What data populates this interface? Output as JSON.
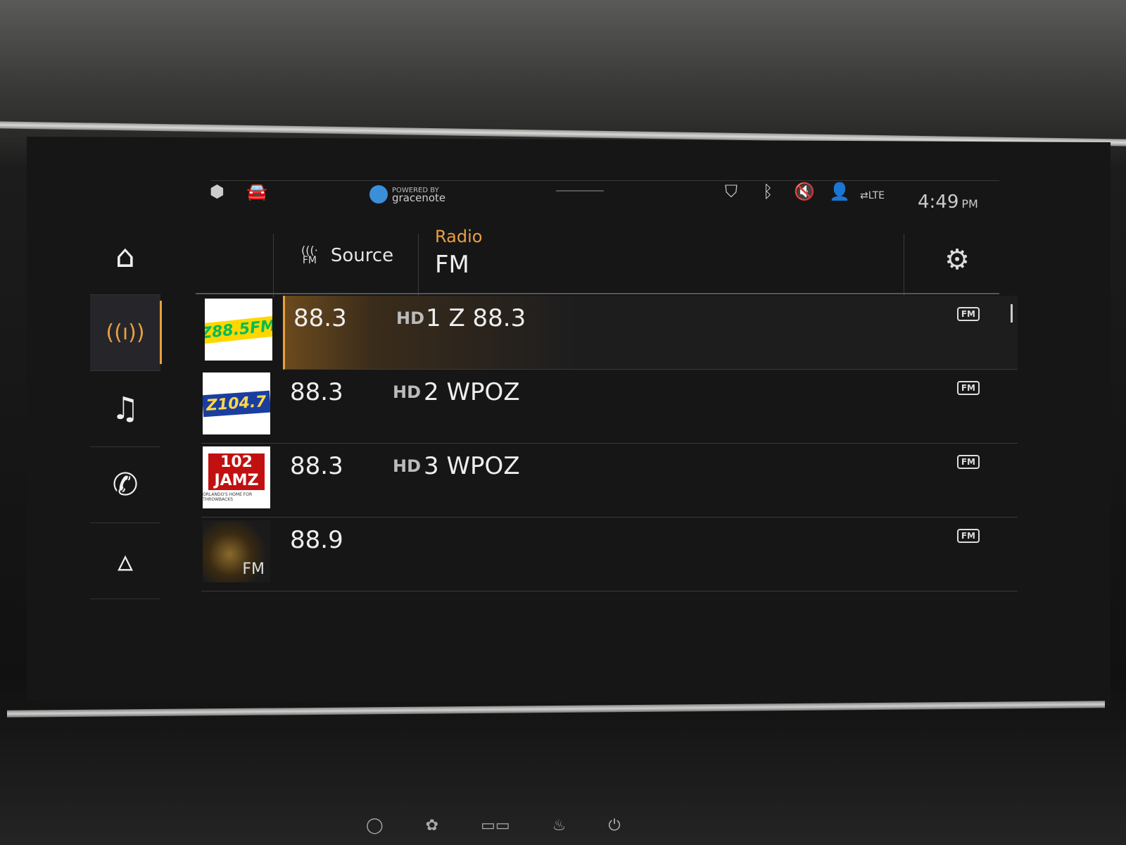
{
  "status_bar": {
    "icons_left": [
      "cube-icon",
      "car-info-icon"
    ],
    "gracenote": {
      "powered_by": "POWERED BY",
      "brand": "gracenote"
    },
    "icons_right": [
      "location-shield-icon",
      "bluetooth-icon",
      "mute-icon",
      "driver-profile-icon",
      "lte-icon"
    ],
    "time": "4:49",
    "ampm": "PM"
  },
  "sidebar": {
    "items": [
      {
        "name": "home",
        "icon": "home-icon",
        "active": false
      },
      {
        "name": "radio",
        "icon": "radio-icon",
        "active": true
      },
      {
        "name": "media",
        "icon": "music-icon",
        "active": false
      },
      {
        "name": "phone",
        "icon": "phone-icon",
        "active": false
      },
      {
        "name": "navigation",
        "icon": "navigation-icon",
        "active": false
      }
    ]
  },
  "header": {
    "source_icon_label": "FM",
    "source_label": "Source",
    "title_small": "Radio",
    "title_large": "FM",
    "settings_icon": "gear-icon"
  },
  "stations": [
    {
      "freq": "88.3",
      "hd": "HD",
      "name": "1 Z 88.3",
      "tag": "FM",
      "logo_text": "Z88.5FM",
      "active": true
    },
    {
      "freq": "88.3",
      "hd": "HD",
      "name": "2 WPOZ",
      "tag": "FM",
      "logo_text": "Z104.7",
      "active": false
    },
    {
      "freq": "88.3",
      "hd": "HD",
      "name": "3 WPOZ",
      "tag": "FM",
      "logo_text": "102 JAMZ",
      "logo_sub": "ORLANDO'S HOME FOR THROWBACKS",
      "active": false
    },
    {
      "freq": "88.9",
      "hd": "",
      "name": "",
      "tag": "FM",
      "logo_text": "FM",
      "active": false
    }
  ],
  "colors": {
    "accent": "#e8a040",
    "screen_bg": "#161617",
    "text": "#eeeeee"
  }
}
